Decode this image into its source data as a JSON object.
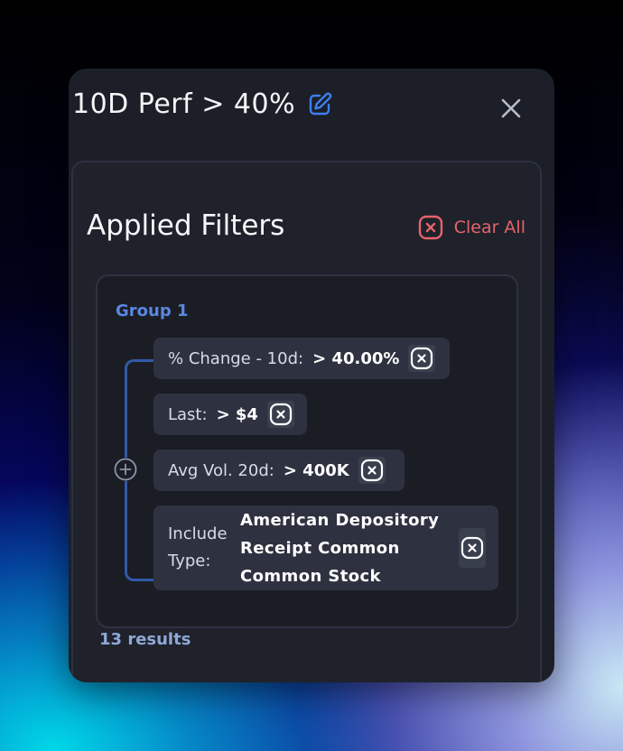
{
  "panel": {
    "title": "10D Perf > 40%",
    "edit_icon": "edit-icon",
    "close_icon": "close-icon"
  },
  "filters": {
    "heading": "Applied Filters",
    "clear_all_label": "Clear All",
    "clear_all_color": "#e8636a",
    "group": {
      "label": "Group 1",
      "items": [
        {
          "label": "% Change - 10d:",
          "value": "> 40.00%"
        },
        {
          "label": "Last:",
          "value": "> $4"
        },
        {
          "label": "Avg Vol. 20d:",
          "value": "> 400K"
        },
        {
          "label": "Include Type:",
          "values": [
            "American Depository",
            "Receipt Common",
            "Common Stock"
          ]
        }
      ]
    }
  },
  "results_text": "13 results",
  "colors": {
    "accent_blue": "#5a87e0",
    "panel_bg": "#1c1f27",
    "chip_bg": "#2e3240"
  }
}
